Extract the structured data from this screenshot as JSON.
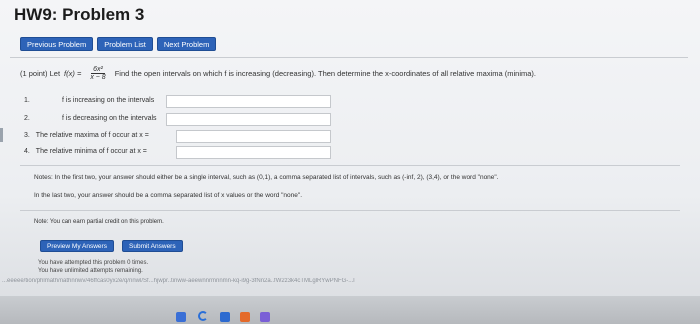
{
  "page_title": "HW9: Problem 3",
  "nav": {
    "previous": "Previous Problem",
    "list": "Problem List",
    "next": "Next Problem"
  },
  "problem": {
    "points": "(1 point) Let",
    "function_lhs": "f(x) =",
    "numerator": "6x²",
    "denominator": "x − 8",
    "instructions": "Find the open intervals on which f is increasing (decreasing). Then determine the x-coordinates of all relative maxima (minima)."
  },
  "questions": [
    {
      "num": "1.",
      "label": "f is increasing on the intervals",
      "value": ""
    },
    {
      "num": "2.",
      "label": "f is decreasing on the intervals",
      "value": ""
    },
    {
      "num": "3.",
      "label": "The relative maxima of f occur at x =",
      "value": ""
    },
    {
      "num": "4.",
      "label": "The relative minima of f occur at x =",
      "value": ""
    }
  ],
  "notes": {
    "line1": "Notes: In the first two, your answer should either be a single interval, such as (0,1), a comma separated list of intervals, such as (-inf, 2), (3,4), or the word \"none\".",
    "line2": "In the last two, your answer should be a comma separated list of x values or the word \"none\"."
  },
  "partial_credit_note": "Note: You can earn partial credit on this problem.",
  "buttons": {
    "preview": "Preview My Answers",
    "submit": "Submit Answers"
  },
  "attempts": {
    "line1": "You have attempted this problem 0 times.",
    "line2": "You have unlimited attempts remaining."
  },
  "url_strip_text": "...eeeee/tion/phlmath/nathnnwv/46ffcas0yx2e/q/nnwl/Sf...hjwpr..tinww-aeewnnrmnnmn-kq-i9g-3fNn2a..fW2z3k4cTMLglRYwPNFG-...l"
}
